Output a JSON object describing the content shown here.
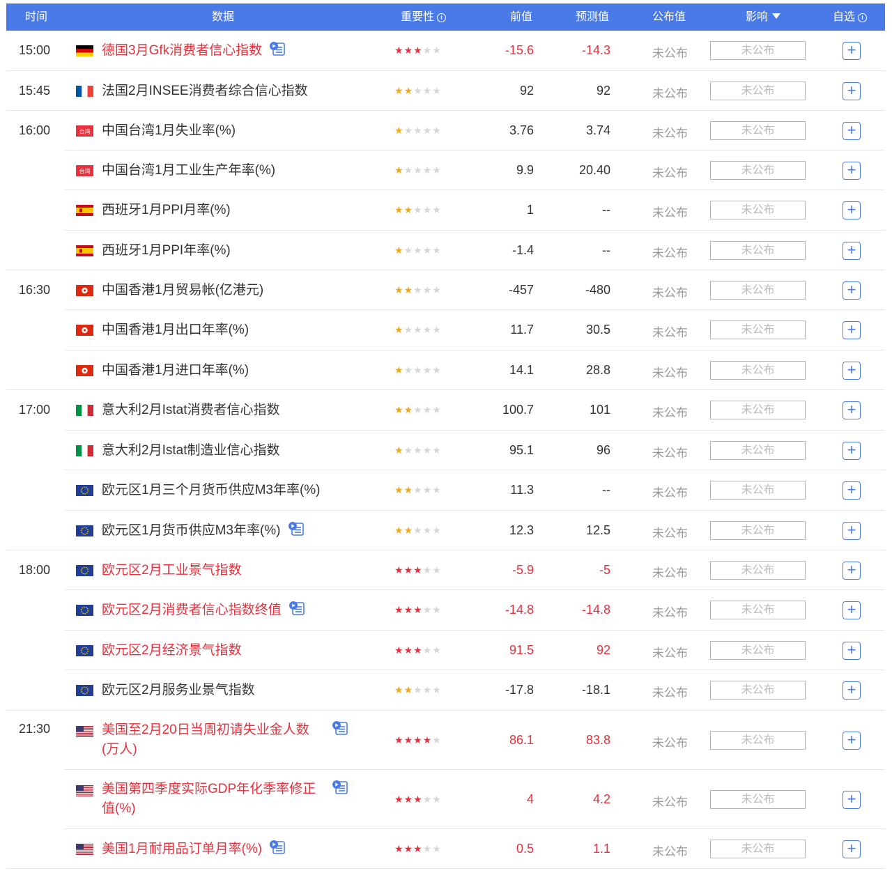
{
  "header": {
    "time": "时间",
    "data": "数据",
    "importance": "重要性",
    "previous": "前值",
    "forecast": "预测值",
    "actual": "公布值",
    "impact": "影响",
    "watchlist": "自选"
  },
  "colors": {
    "header_bg": "#4a7ae8",
    "highlight_red": "#e8313d",
    "star_gold": "#f2a81d",
    "star_empty": "#d6d6d6"
  },
  "rows": [
    {
      "time": "15:00",
      "flag": "de",
      "name": "德国3月Gfk消费者信心指数",
      "red": true,
      "tag": true,
      "stars": 3,
      "prev": "-15.6",
      "forecast": "-14.3",
      "actual": "未公布",
      "impact": "未公布"
    },
    {
      "time": "15:45",
      "flag": "fr",
      "name": "法国2月INSEE消费者综合信心指数",
      "red": false,
      "tag": false,
      "stars": 2,
      "prev": "92",
      "forecast": "92",
      "actual": "未公布",
      "impact": "未公布"
    },
    {
      "time": "16:00",
      "flag": "tw",
      "name": "中国台湾1月失业率(%)",
      "red": false,
      "tag": false,
      "stars": 1,
      "prev": "3.76",
      "forecast": "3.74",
      "actual": "未公布",
      "impact": "未公布"
    },
    {
      "time": "",
      "flag": "tw",
      "name": "中国台湾1月工业生产年率(%)",
      "red": false,
      "tag": false,
      "stars": 1,
      "prev": "9.9",
      "forecast": "20.40",
      "actual": "未公布",
      "impact": "未公布"
    },
    {
      "time": "",
      "flag": "es",
      "name": "西班牙1月PPI月率(%)",
      "red": false,
      "tag": false,
      "stars": 2,
      "prev": "1",
      "forecast": "--",
      "actual": "未公布",
      "impact": "未公布"
    },
    {
      "time": "",
      "flag": "es",
      "name": "西班牙1月PPI年率(%)",
      "red": false,
      "tag": false,
      "stars": 1,
      "prev": "-1.4",
      "forecast": "--",
      "actual": "未公布",
      "impact": "未公布"
    },
    {
      "time": "16:30",
      "flag": "hk",
      "name": "中国香港1月贸易帐(亿港元)",
      "red": false,
      "tag": false,
      "stars": 2,
      "prev": "-457",
      "forecast": "-480",
      "actual": "未公布",
      "impact": "未公布"
    },
    {
      "time": "",
      "flag": "hk",
      "name": "中国香港1月出口年率(%)",
      "red": false,
      "tag": false,
      "stars": 1,
      "prev": "11.7",
      "forecast": "30.5",
      "actual": "未公布",
      "impact": "未公布"
    },
    {
      "time": "",
      "flag": "hk",
      "name": "中国香港1月进口年率(%)",
      "red": false,
      "tag": false,
      "stars": 1,
      "prev": "14.1",
      "forecast": "28.8",
      "actual": "未公布",
      "impact": "未公布"
    },
    {
      "time": "17:00",
      "flag": "it",
      "name": "意大利2月Istat消费者信心指数",
      "red": false,
      "tag": false,
      "stars": 2,
      "prev": "100.7",
      "forecast": "101",
      "actual": "未公布",
      "impact": "未公布"
    },
    {
      "time": "",
      "flag": "it",
      "name": "意大利2月Istat制造业信心指数",
      "red": false,
      "tag": false,
      "stars": 1,
      "prev": "95.1",
      "forecast": "96",
      "actual": "未公布",
      "impact": "未公布"
    },
    {
      "time": "",
      "flag": "eu",
      "name": "欧元区1月三个月货币供应M3年率(%)",
      "red": false,
      "tag": false,
      "stars": 2,
      "prev": "11.3",
      "forecast": "--",
      "actual": "未公布",
      "impact": "未公布"
    },
    {
      "time": "",
      "flag": "eu",
      "name": "欧元区1月货币供应M3年率(%)",
      "red": false,
      "tag": true,
      "stars": 2,
      "prev": "12.3",
      "forecast": "12.5",
      "actual": "未公布",
      "impact": "未公布"
    },
    {
      "time": "18:00",
      "flag": "eu",
      "name": "欧元区2月工业景气指数",
      "red": true,
      "tag": false,
      "stars": 3,
      "prev": "-5.9",
      "forecast": "-5",
      "actual": "未公布",
      "impact": "未公布"
    },
    {
      "time": "",
      "flag": "eu",
      "name": "欧元区2月消费者信心指数终值",
      "red": true,
      "tag": true,
      "stars": 3,
      "prev": "-14.8",
      "forecast": "-14.8",
      "actual": "未公布",
      "impact": "未公布"
    },
    {
      "time": "",
      "flag": "eu",
      "name": "欧元区2月经济景气指数",
      "red": true,
      "tag": false,
      "stars": 3,
      "prev": "91.5",
      "forecast": "92",
      "actual": "未公布",
      "impact": "未公布"
    },
    {
      "time": "",
      "flag": "eu",
      "name": "欧元区2月服务业景气指数",
      "red": false,
      "tag": false,
      "stars": 2,
      "prev": "-17.8",
      "forecast": "-18.1",
      "actual": "未公布",
      "impact": "未公布"
    },
    {
      "time": "21:30",
      "flag": "us",
      "name": "美国至2月20日当周初请失业金人数",
      "name2": "(万人)",
      "red": true,
      "tag": true,
      "stars": 4,
      "prev": "86.1",
      "forecast": "83.8",
      "actual": "未公布",
      "impact": "未公布"
    },
    {
      "time": "",
      "flag": "us",
      "name": "美国第四季度实际GDP年化季率修正",
      "name2": "值(%)",
      "red": true,
      "tag": true,
      "stars": 3,
      "prev": "4",
      "forecast": "4.2",
      "actual": "未公布",
      "impact": "未公布"
    },
    {
      "time": "",
      "flag": "us",
      "name": "美国1月耐用品订单月率(%)",
      "red": true,
      "tag": true,
      "stars": 3,
      "prev": "0.5",
      "forecast": "1.1",
      "actual": "未公布",
      "impact": "未公布"
    }
  ]
}
